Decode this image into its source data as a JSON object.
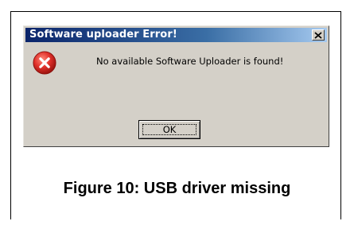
{
  "dialog": {
    "title": "Software uploader Error!",
    "message": "No available Software Uploader is found!",
    "ok_label": "OK",
    "close_symbol": "✕",
    "icon": "error-icon"
  },
  "caption": "Figure 10: USB driver missing",
  "colors": {
    "dialog_bg": "#d4d0c8",
    "titlebar_start": "#0a246a",
    "titlebar_end": "#a6caf0",
    "error_red": "#e0302a"
  }
}
